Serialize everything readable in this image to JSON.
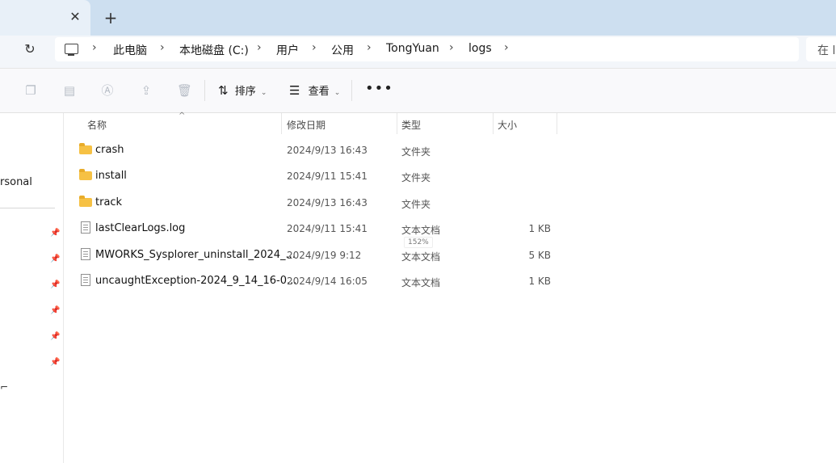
{
  "titlebar": {
    "close_glyph": "✕",
    "new_tab_glyph": "+"
  },
  "addressbar": {
    "refresh_glyph": "↻",
    "breadcrumbs": [
      "此电脑",
      "本地磁盘 (C:)",
      "用户",
      "公用",
      "TongYuan",
      "logs"
    ],
    "search_placeholder": "在 l"
  },
  "toolbar": {
    "sort_label": "排序",
    "view_label": "查看",
    "more_glyph": "•••"
  },
  "nav": {
    "partial_item": "rsonal"
  },
  "columns": {
    "name": "名称",
    "date": "修改日期",
    "type": "类型",
    "size": "大小"
  },
  "files": [
    {
      "name": "crash",
      "date": "2024/9/13 16:43",
      "type": "文件夹",
      "size": "",
      "kind": "folder"
    },
    {
      "name": "install",
      "date": "2024/9/11 15:41",
      "type": "文件夹",
      "size": "",
      "kind": "folder"
    },
    {
      "name": "track",
      "date": "2024/9/13 16:43",
      "type": "文件夹",
      "size": "",
      "kind": "folder"
    },
    {
      "name": "lastClearLogs.log",
      "date": "2024/9/11 15:41",
      "type": "文本文档",
      "size": "1 KB",
      "kind": "doc"
    },
    {
      "name": "MWORKS_Sysplorer_uninstall_2024_...",
      "date": "2024/9/19 9:12",
      "type": "文本文档",
      "size": "5 KB",
      "kind": "doc"
    },
    {
      "name": "uncaughtException-2024_9_14_16-0...",
      "date": "2024/9/14 16:05",
      "type": "文本文档",
      "size": "1 KB",
      "kind": "doc"
    }
  ],
  "zoom_tooltip": "152%",
  "left_edge_glyph": "⌐"
}
